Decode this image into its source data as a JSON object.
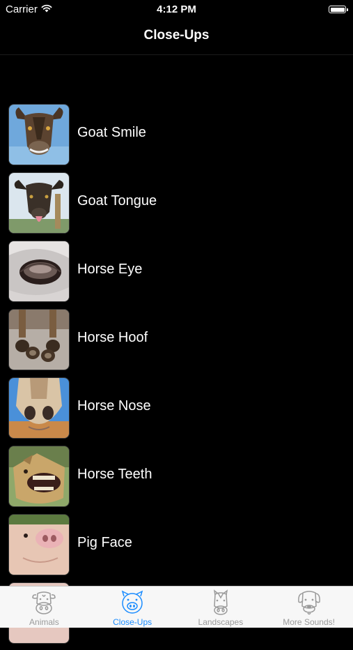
{
  "status_bar": {
    "carrier": "Carrier",
    "time": "4:12 PM"
  },
  "nav": {
    "title": "Close-Ups"
  },
  "items": [
    {
      "label": "Goat Smile"
    },
    {
      "label": "Goat Tongue"
    },
    {
      "label": "Horse Eye"
    },
    {
      "label": "Horse Hoof"
    },
    {
      "label": "Horse Nose"
    },
    {
      "label": "Horse Teeth"
    },
    {
      "label": "Pig Face"
    }
  ],
  "tabs": [
    {
      "label": "Animals",
      "icon": "cow-icon"
    },
    {
      "label": "Close-Ups",
      "icon": "pig-icon",
      "active": true
    },
    {
      "label": "Landscapes",
      "icon": "horse-icon"
    },
    {
      "label": "More Sounds!",
      "icon": "dog-icon"
    }
  ],
  "colors": {
    "background": "#000000",
    "tab_active": "#1a8cff",
    "tab_inactive": "#9a9a9a",
    "tab_bar_bg": "#f7f7f7"
  }
}
